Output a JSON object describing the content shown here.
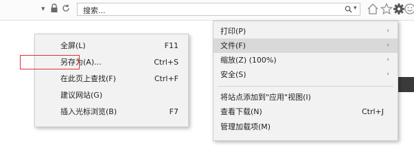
{
  "toolbar": {
    "dropdown_arrow": "▾",
    "lock_icon": "lock-icon",
    "refresh_icon": "refresh-icon",
    "search_text": "搜索...",
    "search_icon": "search-icon",
    "search_dropdown": "▾",
    "home_icon": "home-icon",
    "favorites_icon": "star-icon",
    "tools_icon": "gear-icon",
    "smiley_icon": "smiley-icon"
  },
  "main_menu": {
    "items": [
      {
        "label": "打印(P)",
        "arrow": "›"
      },
      {
        "label": "文件(F)",
        "arrow": "›"
      },
      {
        "label": "缩放(Z) (100%)",
        "arrow": "›"
      },
      {
        "label": "安全(S)",
        "arrow": "›"
      },
      {
        "label": "将站点添加到\"应用\"视图(I)"
      },
      {
        "label": "查看下载(N)",
        "shortcut": "Ctrl+J"
      },
      {
        "label": "管理加载项(M)"
      }
    ]
  },
  "sub_menu": {
    "items": [
      {
        "label": "全屏(L)",
        "shortcut": "F11"
      },
      {
        "label": "另存为(A)...",
        "shortcut": "Ctrl+S"
      },
      {
        "label": "在此页上查找(F)",
        "shortcut": "Ctrl+F"
      },
      {
        "label": "建议网站(G)"
      },
      {
        "label": "插入光标浏览(B)",
        "shortcut": "F7"
      }
    ]
  },
  "colors": {
    "highlight": "#d9d9d9",
    "annotation_box": "#e03030",
    "menu_bg": "#f2f2f2"
  }
}
